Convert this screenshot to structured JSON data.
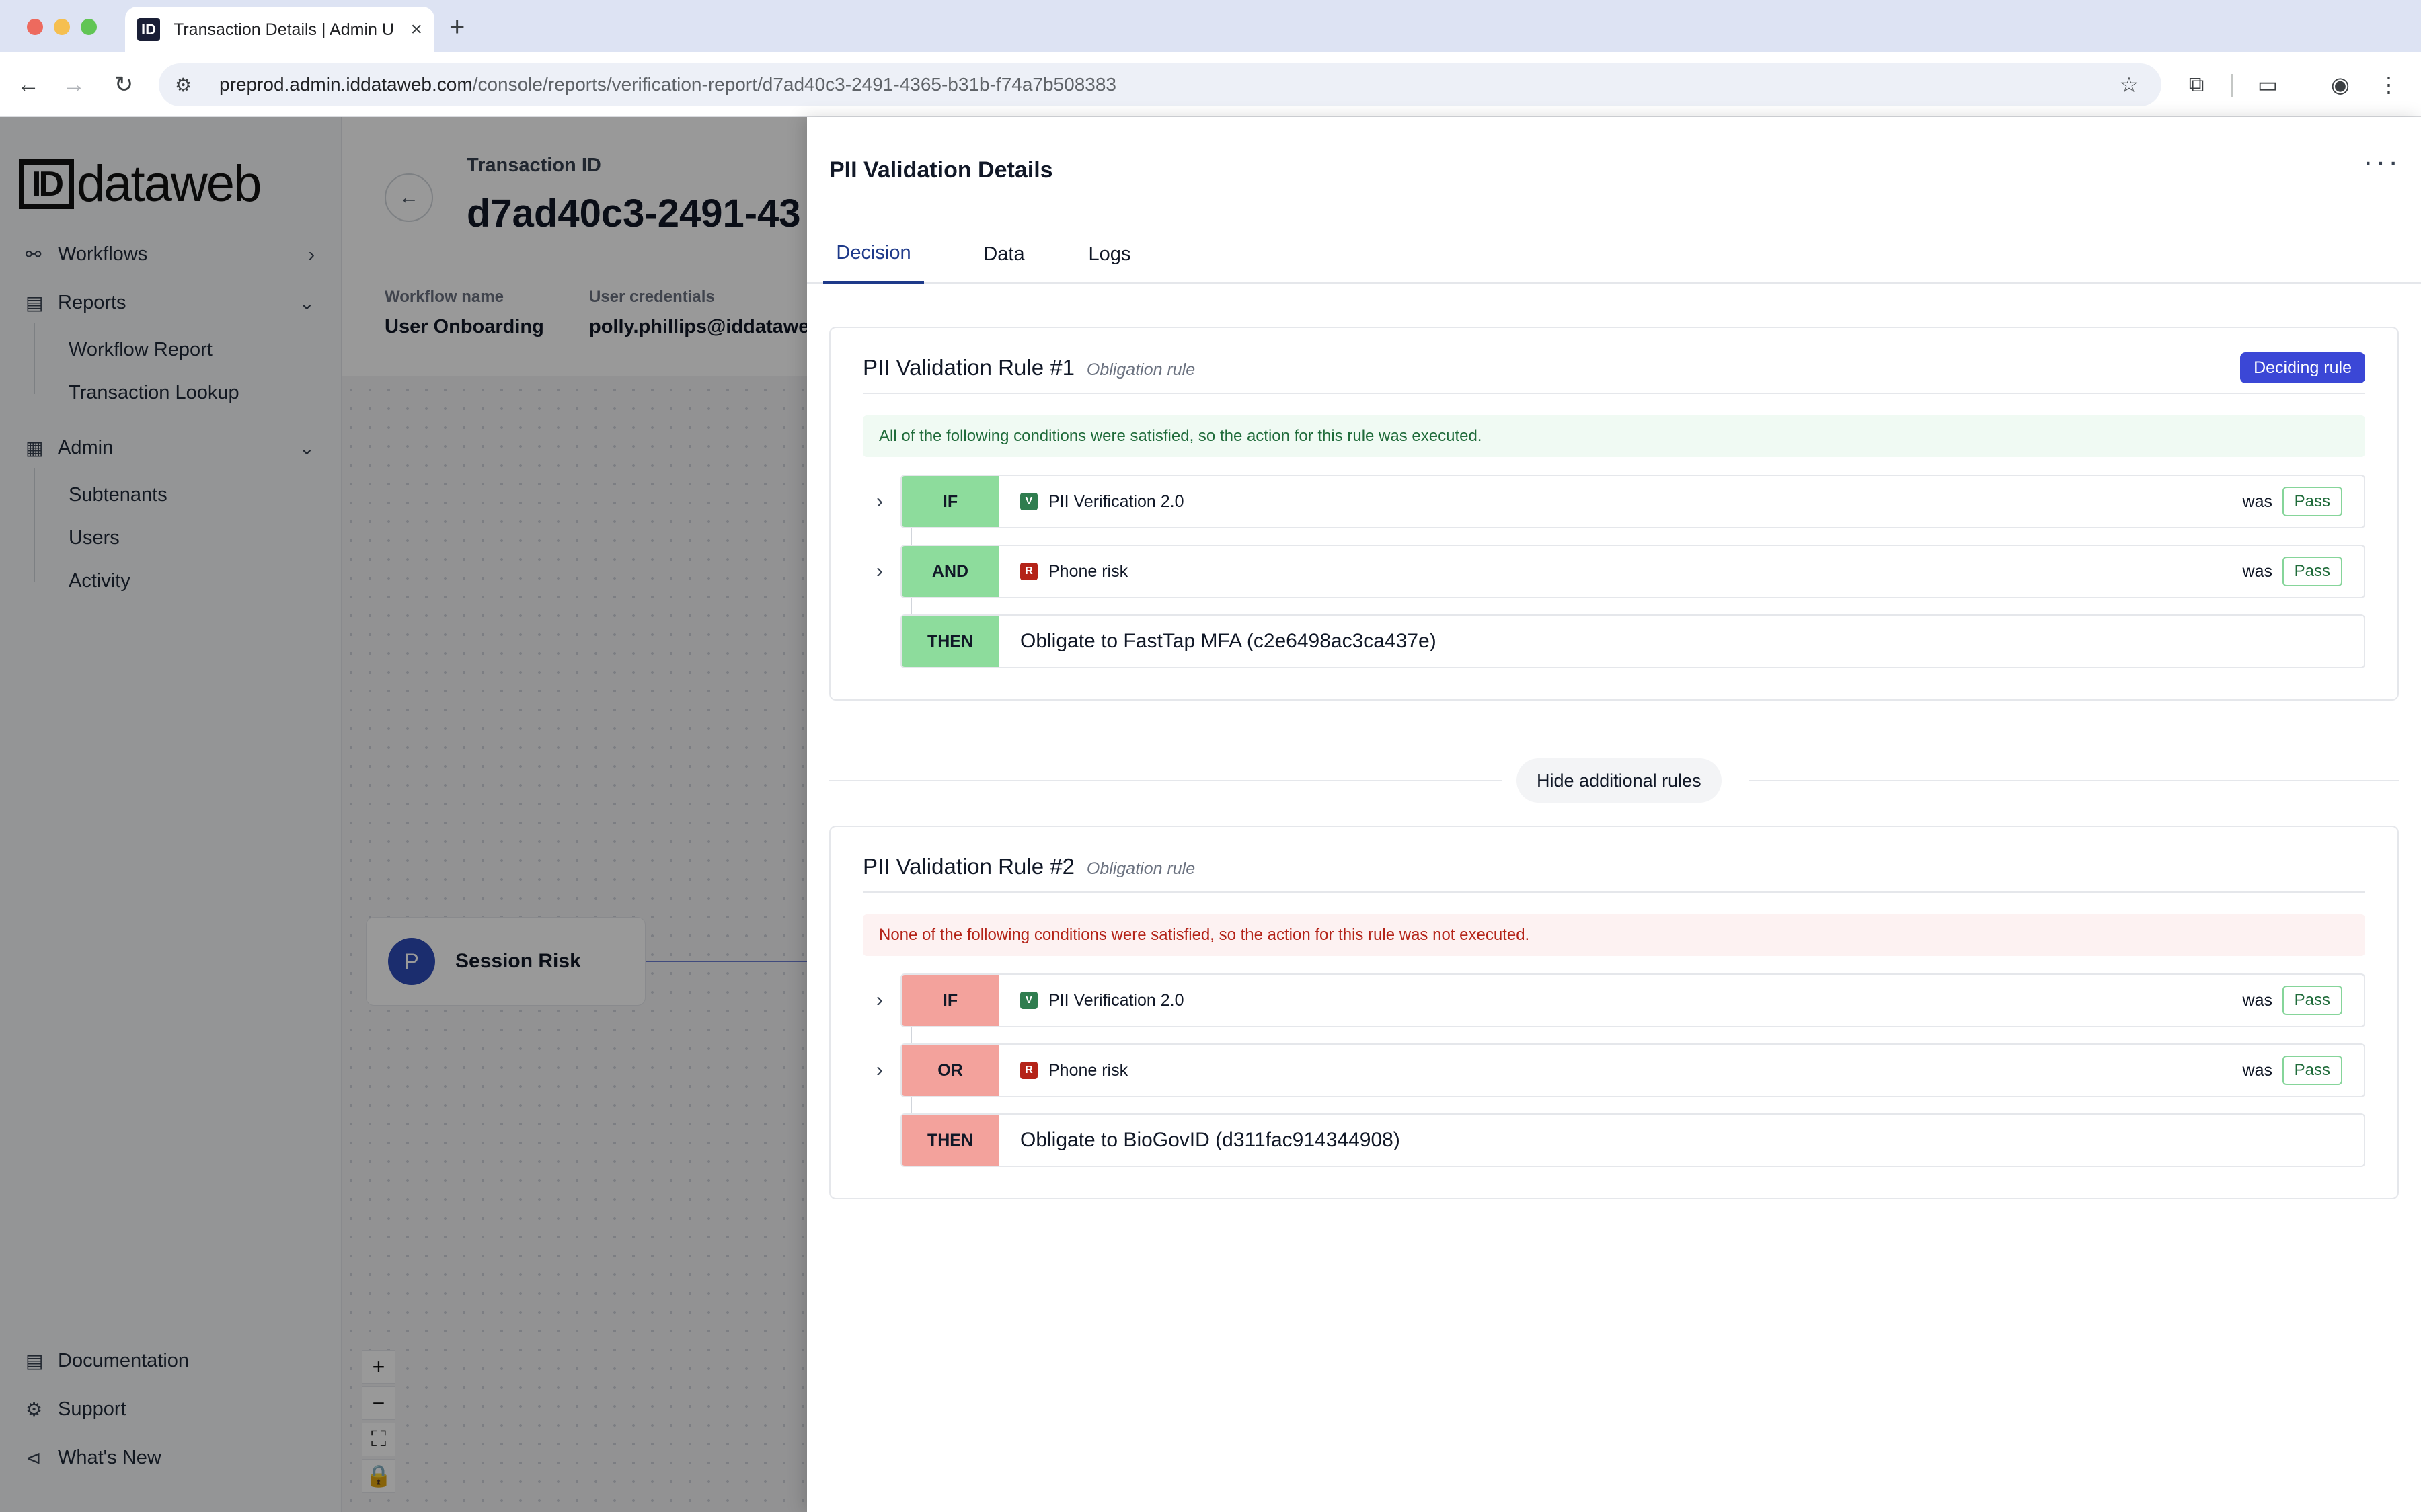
{
  "browser": {
    "tab_title": "Transaction Details | Admin U",
    "favicon_text": "ID",
    "url_host": "preprod.admin.iddataweb.com",
    "url_path": "/console/reports/verification-report/d7ad40c3-2491-4365-b31b-f74a7b508383"
  },
  "sidebar": {
    "logo_id": "ID",
    "logo_text": "dataweb",
    "items": {
      "workflows": "Workflows",
      "reports": "Reports",
      "workflow_report": "Workflow Report",
      "transaction_lookup": "Transaction Lookup",
      "admin": "Admin",
      "subtenants": "Subtenants",
      "users": "Users",
      "activity": "Activity",
      "documentation": "Documentation",
      "support": "Support",
      "whats_new": "What's New"
    }
  },
  "main": {
    "txn_label": "Transaction ID",
    "txn_id": "d7ad40c3-2491-43",
    "workflow_name_label": "Workflow name",
    "workflow_name": "User Onboarding",
    "credentials_label": "User credentials",
    "credentials": "polly.phillips@iddatawel",
    "node_avatar": "P",
    "node_label": "Session Risk"
  },
  "drawer": {
    "title": "PII Validation Details",
    "tabs": [
      "Decision",
      "Data",
      "Logs"
    ],
    "hide_rules_label": "Hide additional rules",
    "rules": [
      {
        "title": "PII Validation Rule #1",
        "type": "Obligation rule",
        "deciding_label": "Deciding rule",
        "banner": "All of the following conditions were satisfied, so the action for this rule was executed.",
        "conditions": [
          {
            "key": "IF",
            "badge": "V",
            "name": "PII Verification 2.0",
            "was": "was",
            "result": "Pass"
          },
          {
            "key": "AND",
            "badge": "R",
            "name": "Phone risk",
            "was": "was",
            "result": "Pass"
          }
        ],
        "then_key": "THEN",
        "then_text": "Obligate to FastTap MFA (c2e6498ac3ca437e)"
      },
      {
        "title": "PII Validation Rule #2",
        "type": "Obligation rule",
        "banner": "None of the following conditions were satisfied, so the action for this rule was not executed.",
        "conditions": [
          {
            "key": "IF",
            "badge": "V",
            "name": "PII Verification 2.0",
            "was": "was",
            "result": "Pass"
          },
          {
            "key": "OR",
            "badge": "R",
            "name": "Phone risk",
            "was": "was",
            "result": "Pass"
          }
        ],
        "then_key": "THEN",
        "then_text": "Obligate to BioGovID (d311fac914344908)"
      }
    ]
  },
  "colors": {
    "accent": "#3b47d6",
    "pass_green": "#8ddc9c",
    "fail_red": "#f3a29c"
  }
}
